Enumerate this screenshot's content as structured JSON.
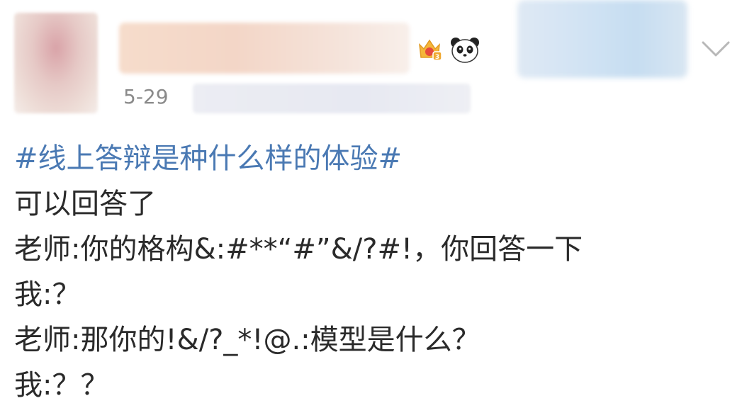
{
  "post": {
    "date": "5-29",
    "hashtag": "#线上答辩是种什么样的体验#",
    "lines": [
      "可以回答了",
      "老师:你的格构&:#**“#”&/?#!，你回答一下",
      "我:？",
      "老师:那你的!&/?_*!@.:模型是什么？",
      "我:？？"
    ]
  },
  "icons": {
    "vip_badge": "vip-crown-icon",
    "panda": "panda-emoji-icon",
    "menu": "chevron-down-icon"
  },
  "colors": {
    "hashtag": "#4a79b3",
    "text": "#2a2a2a",
    "meta": "#8a8a8a"
  }
}
